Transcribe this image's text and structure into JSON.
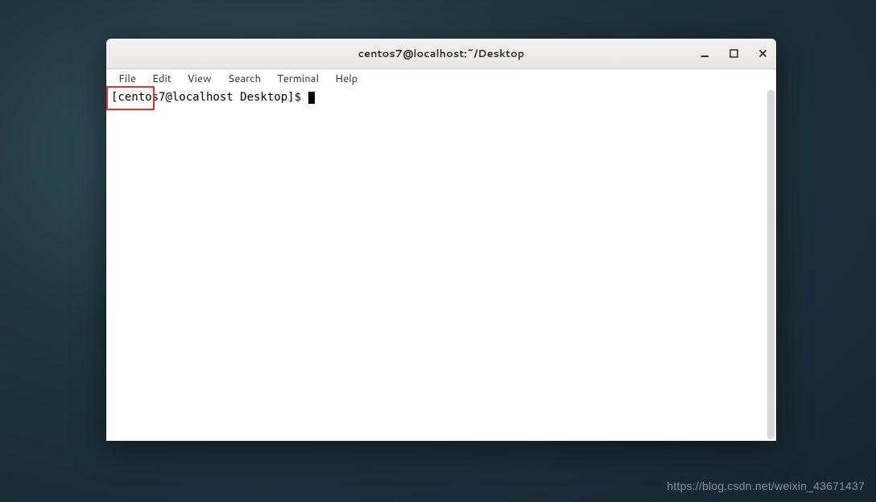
{
  "window": {
    "title": "centos7@localhost:~/Desktop"
  },
  "menubar": {
    "items": [
      "File",
      "Edit",
      "View",
      "Search",
      "Terminal",
      "Help"
    ]
  },
  "terminal": {
    "prompt": "[centos7@localhost Desktop]$ "
  },
  "watermark": "https://blog.csdn.net/weixin_43671437"
}
